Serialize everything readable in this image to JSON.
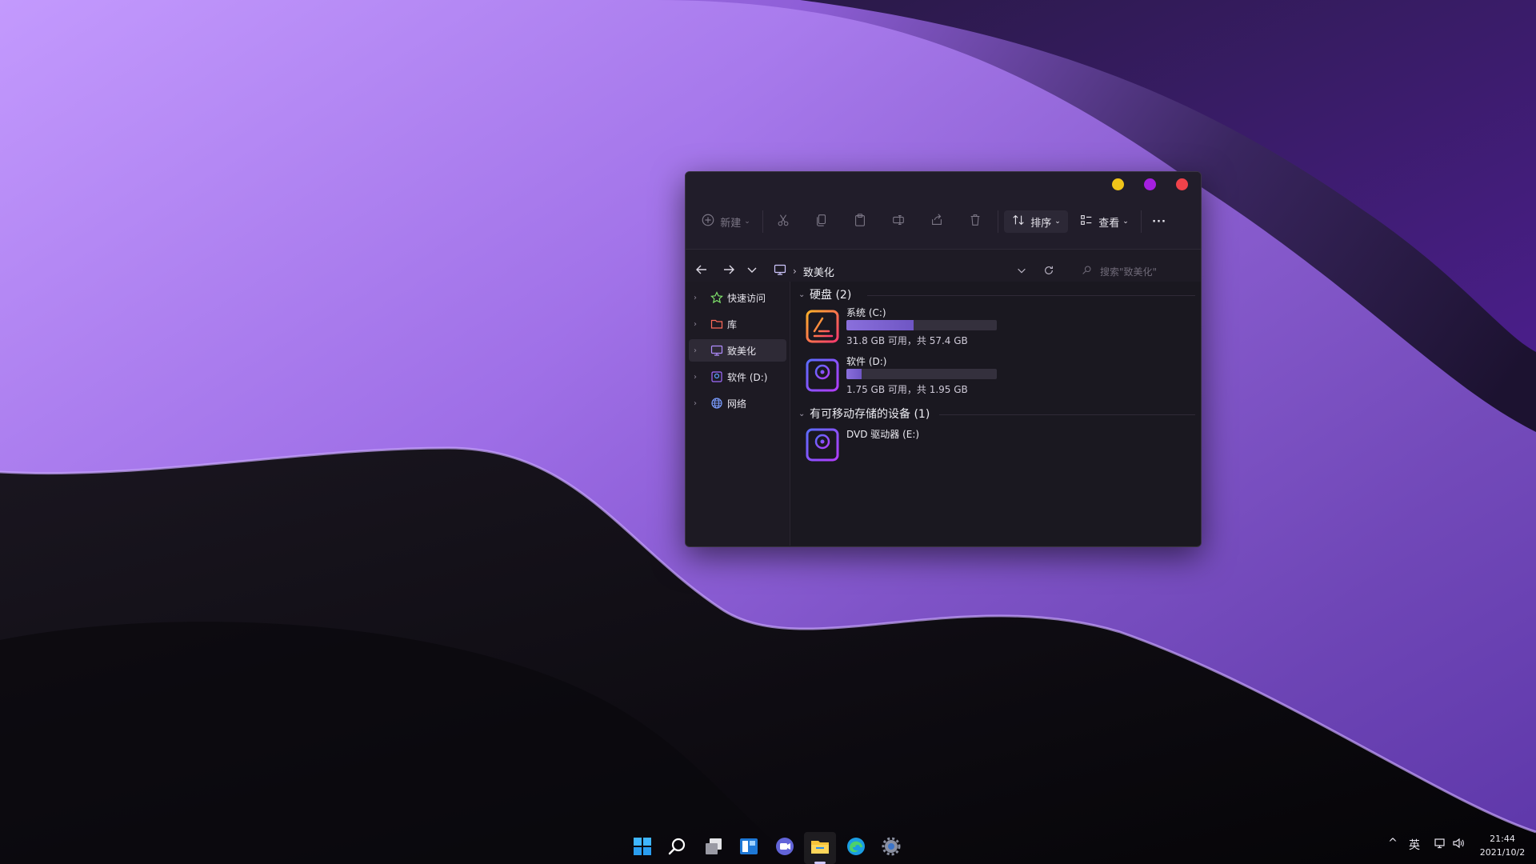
{
  "window": {
    "controls": [
      "minimize-button",
      "maximize-button",
      "close-button"
    ],
    "control_colors": {
      "minimize": "#f0c419",
      "maximize": "#a51fe0",
      "close": "#f0424a"
    }
  },
  "toolbar": {
    "new_label": "新建",
    "sort_label": "排序",
    "view_label": "查看",
    "more_label": "···",
    "icons": [
      "add-circle-icon",
      "cut-icon",
      "copy-icon",
      "paste-icon",
      "rename-icon",
      "share-icon",
      "delete-icon",
      "sort-icon",
      "view-icon"
    ]
  },
  "address": {
    "crumb_label": "致美化",
    "crumb_separator": "›",
    "search_placeholder": "搜索\"致美化\""
  },
  "sidebar": {
    "items": [
      {
        "label": "快速访问",
        "icon": "star-icon"
      },
      {
        "label": "库",
        "icon": "folder-icon"
      },
      {
        "label": "致美化",
        "icon": "computer-icon",
        "selected": true
      },
      {
        "label": "软件 (D:)",
        "icon": "drive-icon"
      },
      {
        "label": "网络",
        "icon": "globe-icon"
      }
    ]
  },
  "content": {
    "groups": [
      {
        "title": "硬盘 (2)"
      },
      {
        "title": "有可移动存储的设备 (1)"
      }
    ],
    "drives": [
      {
        "name": "系统 (C:)",
        "info": "31.8 GB 可用，共 57.4 GB",
        "used_fraction": 0.446,
        "icon": "system-drive-icon"
      },
      {
        "name": "软件 (D:)",
        "info": "1.75 GB 可用，共 1.95 GB",
        "used_fraction": 0.103,
        "icon": "disk-drive-icon"
      },
      {
        "name": "DVD 驱动器 (E:)",
        "icon": "dvd-drive-icon"
      }
    ]
  },
  "taskbar": {
    "icons": [
      "start-icon",
      "search-icon",
      "task-view-icon",
      "widgets-icon",
      "chat-icon",
      "file-explorer-icon",
      "edge-icon",
      "settings-icon"
    ],
    "active": "file-explorer-icon",
    "tray": {
      "chevron": "^",
      "ime": "英",
      "time": "21:44",
      "date": "2021/10/2"
    }
  },
  "colors": {
    "accent": "#8a6fdc",
    "wallpaper_purple": "#a77ff0"
  }
}
